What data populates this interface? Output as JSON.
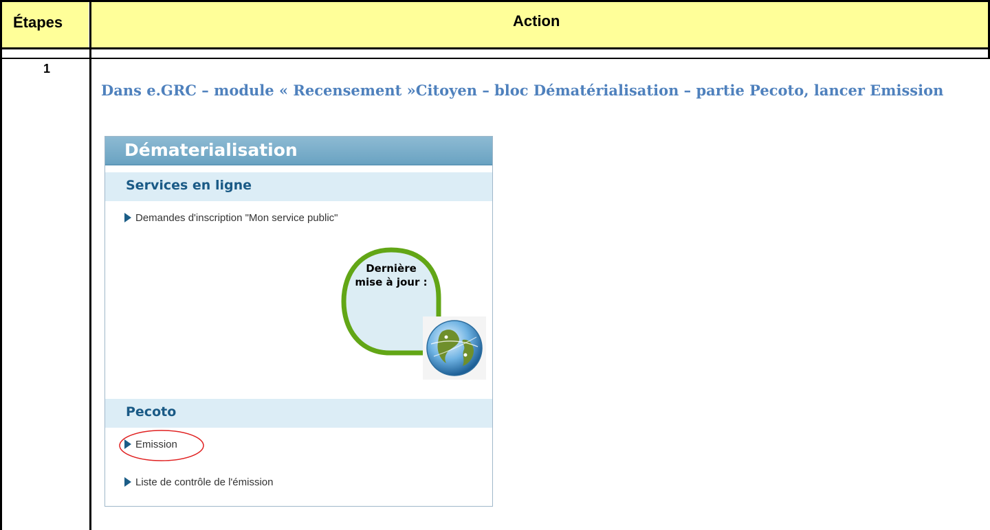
{
  "table": {
    "col_steps_header": "Étapes",
    "col_action_header": "Action",
    "header_bg": "#ffff99",
    "rows": [
      {
        "step": "1",
        "instruction": "Dans e.GRC – module « Recensement »Citoyen – bloc Dématérialisation – partie Pecoto, lancer Emission"
      }
    ]
  },
  "screenshot": {
    "panel_title": "Dématerialisation",
    "section_online": "Services en ligne",
    "online_link": "Demandes d'inscription \"Mon service public\"",
    "bubble_line1": "Dernière",
    "bubble_line2": "mise à jour :",
    "section_pecoto": "Pecoto",
    "pecoto_links": [
      "Emission",
      "Liste de contrôle de l'émission"
    ],
    "highlight_color": "#e02020",
    "accent_color": "#1a5a86"
  }
}
